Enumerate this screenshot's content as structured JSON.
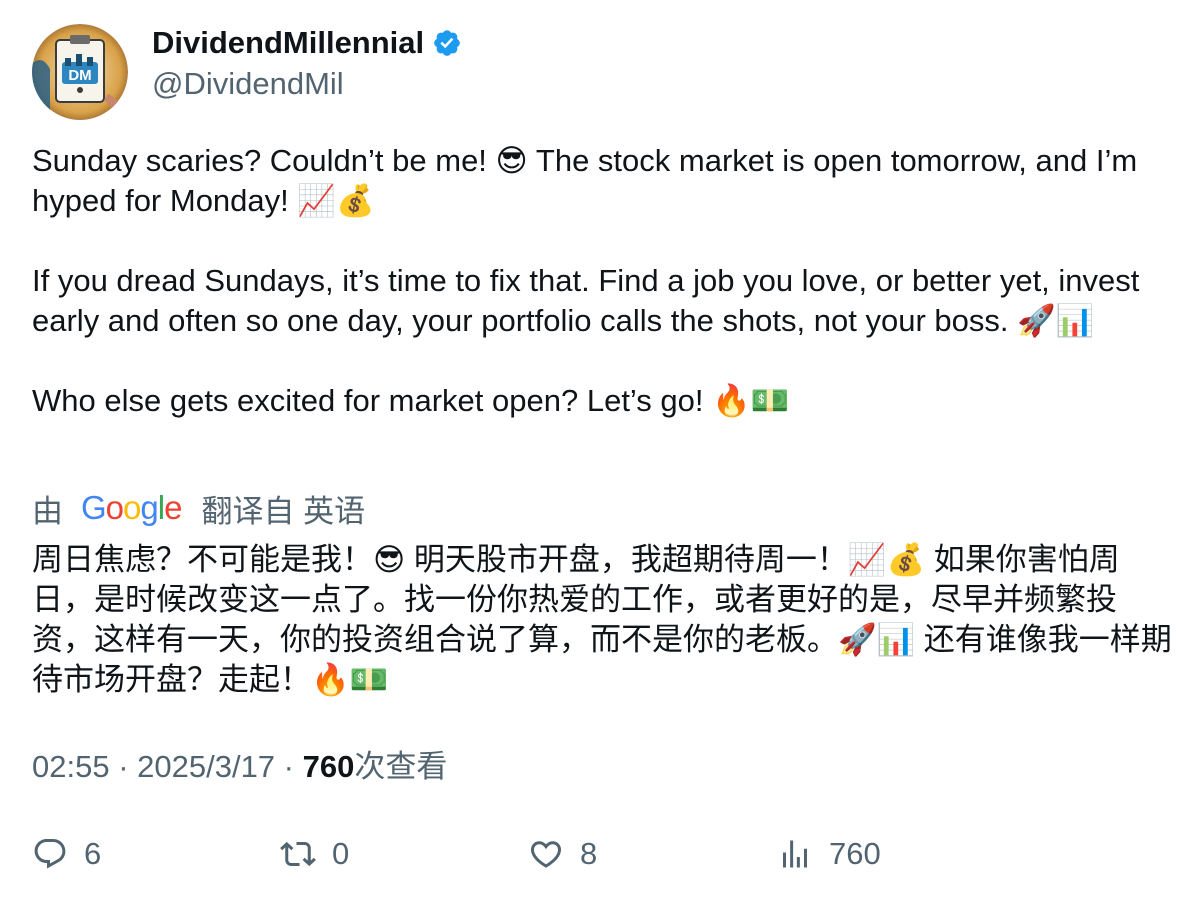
{
  "author": {
    "display_name": "DividendMillennial",
    "handle": "@DividendMil",
    "avatar_initials": "DM",
    "verified_icon": "verified-badge-icon"
  },
  "tweet": {
    "text": "Sunday scaries? Couldn’t be me! 😎 The stock market is open tomorrow, and I’m hyped for Monday! 📈💰\n\nIf you dread Sundays, it’s time to fix that. Find a job you love, or better yet, invest early and often so one day, your portfolio calls the shots, not your boss. 🚀📊\n\nWho else gets excited for market open? Let’s go! 🔥💵"
  },
  "translation": {
    "by_label": "由",
    "provider_letters": [
      "G",
      "o",
      "o",
      "g",
      "l",
      "e"
    ],
    "source_label": "翻译自 英语",
    "text": "周日焦虑？不可能是我！😎 明天股市开盘，我超期待周一！📈💰 如果你害怕周日，是时候改变这一点了。找一份你热爱的工作，或者更好的是，尽早并频繁投资，这样有一天，你的投资组合说了算，而不是你的老板。🚀📊 还有谁像我一样期待市场开盘？走起！🔥💵"
  },
  "meta": {
    "time": "02:55",
    "separator": " · ",
    "date": "2025/3/17",
    "views_count": "760",
    "views_label": "次查看"
  },
  "actions": {
    "reply_count": "6",
    "retweet_count": "0",
    "like_count": "8",
    "views_count": "760"
  },
  "colors": {
    "text_primary": "#0f1419",
    "text_secondary": "#536471",
    "verified_blue": "#1d9bf0",
    "google_blue": "#4285F4",
    "google_red": "#EA4335",
    "google_yellow": "#FBBC05",
    "google_green": "#34A853"
  }
}
